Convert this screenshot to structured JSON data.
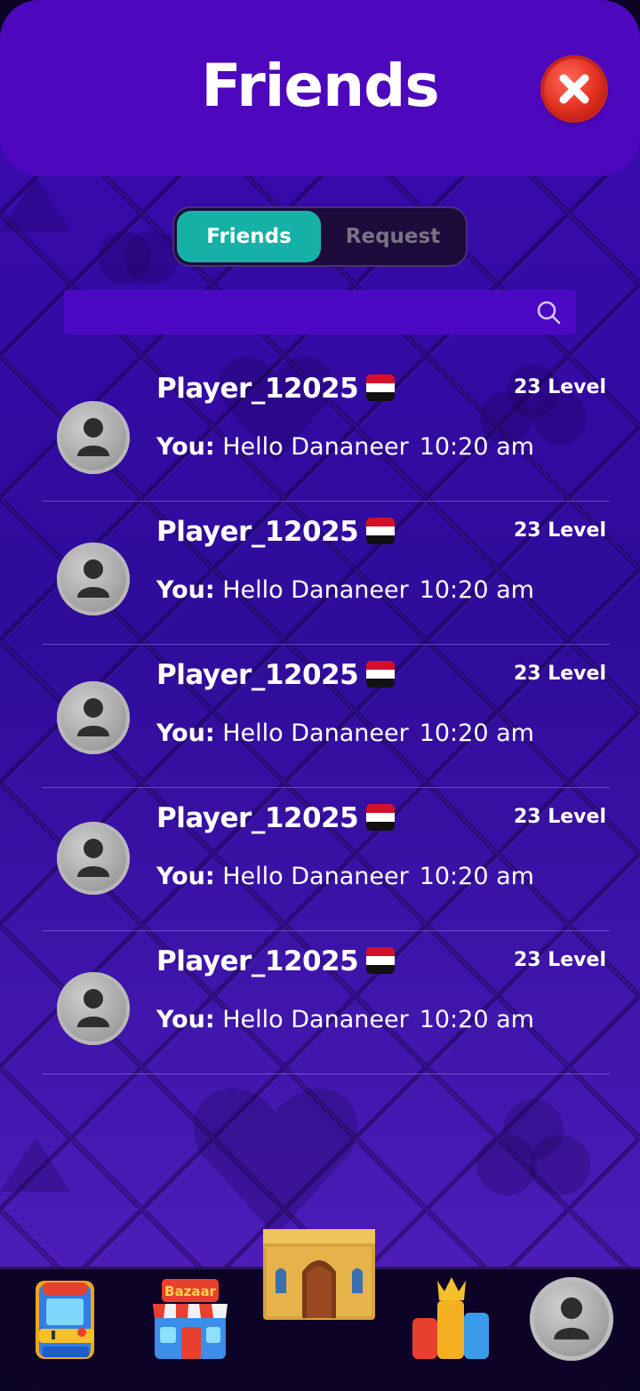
{
  "header": {
    "title": "Friends",
    "close_icon": "close-icon"
  },
  "tabs": {
    "friends_label": "Friends",
    "request_label": "Request",
    "active": "Friends"
  },
  "search": {
    "placeholder": "",
    "icon": "search-icon"
  },
  "friends": [
    {
      "name": "Player_12025",
      "flag": "iraq-flag",
      "level": "23 Level",
      "sender": "You:",
      "message": "Hello Dananeer",
      "time": "10:20 am"
    },
    {
      "name": "Player_12025",
      "flag": "iraq-flag",
      "level": "23 Level",
      "sender": "You:",
      "message": "Hello Dananeer",
      "time": "10:20 am"
    },
    {
      "name": "Player_12025",
      "flag": "iraq-flag",
      "level": "23 Level",
      "sender": "You:",
      "message": "Hello Dananeer",
      "time": "10:20 am"
    },
    {
      "name": "Player_12025",
      "flag": "iraq-flag",
      "level": "23 Level",
      "sender": "You:",
      "message": "Hello Dananeer",
      "time": "10:20 am"
    },
    {
      "name": "Player_12025",
      "flag": "iraq-flag",
      "level": "23 Level",
      "sender": "You:",
      "message": "Hello Dananeer",
      "time": "10:20 am"
    }
  ],
  "bottom_nav": {
    "arcade_icon": "arcade-machine-icon",
    "bazaar_icon": "bazaar-shop-icon",
    "bazaar_sign": "Bazaar",
    "home_icon": "palace-home-icon",
    "leaderboard_icon": "leaderboard-crown-icon",
    "profile_icon": "profile-avatar-icon"
  },
  "colors": {
    "header_bg": "#4d08bd",
    "tab_active": "#16b1a6",
    "search_bg": "#4c09c3",
    "bottom_bar": "#0d0327",
    "close_red": "#e23020"
  }
}
